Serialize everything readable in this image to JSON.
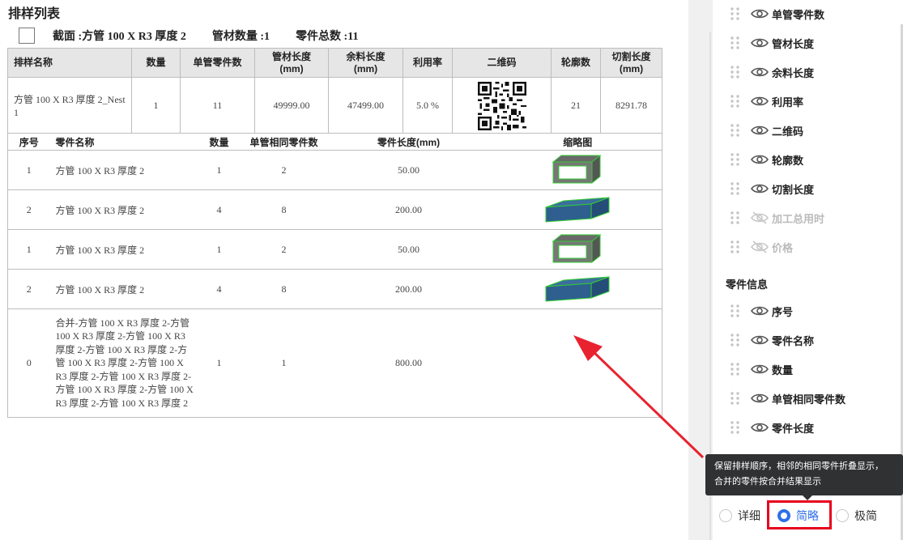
{
  "report": {
    "title": "排样列表",
    "summary": {
      "section": "截面 :方管 100 X R3 厚度 2",
      "tube_count": "管材数量 :1",
      "part_total": "零件总数 :11"
    },
    "nest_table": {
      "headers": [
        "排样名称",
        "数量",
        "单管零件数",
        "管材长度\n(mm)",
        "余料长度\n(mm)",
        "利用率",
        "二维码",
        "轮廓数",
        "切割长度\n(mm)"
      ],
      "rows": [
        {
          "name": "方管 100 X R3 厚度 2_Nest 1",
          "quantity": "1",
          "parts_per_tube": "11",
          "tube_length": "49999.00",
          "remnant_length": "47499.00",
          "utilization": "5.0 %",
          "contours": "21",
          "cut_length": "8291.78"
        }
      ]
    },
    "parts_table": {
      "headers": [
        "序号",
        "零件名称",
        "数量",
        "单管相同零件数",
        "零件长度(mm)",
        "缩略图"
      ],
      "rows": [
        {
          "seq": "1",
          "name": "方管 100 X R3 厚度 2",
          "qty": "1",
          "same_count": "2",
          "length": "50.00",
          "thumb": "short-tube"
        },
        {
          "seq": "2",
          "name": "方管 100 X R3 厚度 2",
          "qty": "4",
          "same_count": "8",
          "length": "200.00",
          "thumb": "long-tube"
        },
        {
          "seq": "1",
          "name": "方管 100 X R3 厚度 2",
          "qty": "1",
          "same_count": "2",
          "length": "50.00",
          "thumb": "short-tube"
        },
        {
          "seq": "2",
          "name": "方管 100 X R3 厚度 2",
          "qty": "4",
          "same_count": "8",
          "length": "200.00",
          "thumb": "long-tube"
        },
        {
          "seq": "0",
          "name": "合并-方管 100 X R3 厚度 2-方管 100 X R3 厚度 2-方管 100 X R3 厚度 2-方管 100 X R3 厚度 2-方管 100 X R3 厚度 2-方管 100 X R3 厚度 2-方管 100 X R3 厚度 2-方管 100 X R3 厚度 2-方管 100 X R3 厚度 2-方管 100 X R3 厚度 2",
          "qty": "1",
          "same_count": "1",
          "length": "800.00",
          "thumb": ""
        }
      ]
    }
  },
  "panel": {
    "nest_fields": [
      {
        "label": "单管零件数",
        "visible": true
      },
      {
        "label": "管材长度",
        "visible": true
      },
      {
        "label": "余料长度",
        "visible": true
      },
      {
        "label": "利用率",
        "visible": true
      },
      {
        "label": "二维码",
        "visible": true
      },
      {
        "label": "轮廓数",
        "visible": true
      },
      {
        "label": "切割长度",
        "visible": true
      },
      {
        "label": "加工总用时",
        "visible": false
      },
      {
        "label": "价格",
        "visible": false
      }
    ],
    "part_section_title": "零件信息",
    "part_fields": [
      {
        "label": "序号",
        "visible": true
      },
      {
        "label": "零件名称",
        "visible": true
      },
      {
        "label": "数量",
        "visible": true
      },
      {
        "label": "单管相同零件数",
        "visible": true
      },
      {
        "label": "零件长度",
        "visible": true
      }
    ],
    "tooltip": {
      "line1": "保留排样顺序，相邻的相同零件折叠显示，",
      "line2": "合并的零件按合并结果显示"
    },
    "display_modes": {
      "options": [
        "详细",
        "简略",
        "极简"
      ],
      "selected": "简略"
    }
  },
  "colors": {
    "accent": "#2f6fe8",
    "highlight": "#e8001c",
    "tube_fill": "#2e5f8f",
    "tube_edge": "#33cc33",
    "header_bg": "#e6e6e6"
  }
}
